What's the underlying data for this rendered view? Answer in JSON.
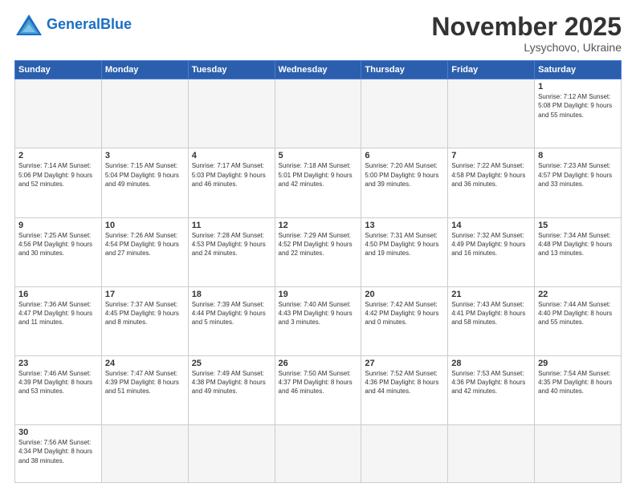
{
  "header": {
    "logo_general": "General",
    "logo_blue": "Blue",
    "month_title": "November 2025",
    "location": "Lysychovo, Ukraine"
  },
  "days_of_week": [
    "Sunday",
    "Monday",
    "Tuesday",
    "Wednesday",
    "Thursday",
    "Friday",
    "Saturday"
  ],
  "weeks": [
    [
      {
        "day": "",
        "info": ""
      },
      {
        "day": "",
        "info": ""
      },
      {
        "day": "",
        "info": ""
      },
      {
        "day": "",
        "info": ""
      },
      {
        "day": "",
        "info": ""
      },
      {
        "day": "",
        "info": ""
      },
      {
        "day": "1",
        "info": "Sunrise: 7:12 AM\nSunset: 5:08 PM\nDaylight: 9 hours\nand 55 minutes."
      }
    ],
    [
      {
        "day": "2",
        "info": "Sunrise: 7:14 AM\nSunset: 5:06 PM\nDaylight: 9 hours\nand 52 minutes."
      },
      {
        "day": "3",
        "info": "Sunrise: 7:15 AM\nSunset: 5:04 PM\nDaylight: 9 hours\nand 49 minutes."
      },
      {
        "day": "4",
        "info": "Sunrise: 7:17 AM\nSunset: 5:03 PM\nDaylight: 9 hours\nand 46 minutes."
      },
      {
        "day": "5",
        "info": "Sunrise: 7:18 AM\nSunset: 5:01 PM\nDaylight: 9 hours\nand 42 minutes."
      },
      {
        "day": "6",
        "info": "Sunrise: 7:20 AM\nSunset: 5:00 PM\nDaylight: 9 hours\nand 39 minutes."
      },
      {
        "day": "7",
        "info": "Sunrise: 7:22 AM\nSunset: 4:58 PM\nDaylight: 9 hours\nand 36 minutes."
      },
      {
        "day": "8",
        "info": "Sunrise: 7:23 AM\nSunset: 4:57 PM\nDaylight: 9 hours\nand 33 minutes."
      }
    ],
    [
      {
        "day": "9",
        "info": "Sunrise: 7:25 AM\nSunset: 4:56 PM\nDaylight: 9 hours\nand 30 minutes."
      },
      {
        "day": "10",
        "info": "Sunrise: 7:26 AM\nSunset: 4:54 PM\nDaylight: 9 hours\nand 27 minutes."
      },
      {
        "day": "11",
        "info": "Sunrise: 7:28 AM\nSunset: 4:53 PM\nDaylight: 9 hours\nand 24 minutes."
      },
      {
        "day": "12",
        "info": "Sunrise: 7:29 AM\nSunset: 4:52 PM\nDaylight: 9 hours\nand 22 minutes."
      },
      {
        "day": "13",
        "info": "Sunrise: 7:31 AM\nSunset: 4:50 PM\nDaylight: 9 hours\nand 19 minutes."
      },
      {
        "day": "14",
        "info": "Sunrise: 7:32 AM\nSunset: 4:49 PM\nDaylight: 9 hours\nand 16 minutes."
      },
      {
        "day": "15",
        "info": "Sunrise: 7:34 AM\nSunset: 4:48 PM\nDaylight: 9 hours\nand 13 minutes."
      }
    ],
    [
      {
        "day": "16",
        "info": "Sunrise: 7:36 AM\nSunset: 4:47 PM\nDaylight: 9 hours\nand 11 minutes."
      },
      {
        "day": "17",
        "info": "Sunrise: 7:37 AM\nSunset: 4:45 PM\nDaylight: 9 hours\nand 8 minutes."
      },
      {
        "day": "18",
        "info": "Sunrise: 7:39 AM\nSunset: 4:44 PM\nDaylight: 9 hours\nand 5 minutes."
      },
      {
        "day": "19",
        "info": "Sunrise: 7:40 AM\nSunset: 4:43 PM\nDaylight: 9 hours\nand 3 minutes."
      },
      {
        "day": "20",
        "info": "Sunrise: 7:42 AM\nSunset: 4:42 PM\nDaylight: 9 hours\nand 0 minutes."
      },
      {
        "day": "21",
        "info": "Sunrise: 7:43 AM\nSunset: 4:41 PM\nDaylight: 8 hours\nand 58 minutes."
      },
      {
        "day": "22",
        "info": "Sunrise: 7:44 AM\nSunset: 4:40 PM\nDaylight: 8 hours\nand 55 minutes."
      }
    ],
    [
      {
        "day": "23",
        "info": "Sunrise: 7:46 AM\nSunset: 4:39 PM\nDaylight: 8 hours\nand 53 minutes."
      },
      {
        "day": "24",
        "info": "Sunrise: 7:47 AM\nSunset: 4:39 PM\nDaylight: 8 hours\nand 51 minutes."
      },
      {
        "day": "25",
        "info": "Sunrise: 7:49 AM\nSunset: 4:38 PM\nDaylight: 8 hours\nand 49 minutes."
      },
      {
        "day": "26",
        "info": "Sunrise: 7:50 AM\nSunset: 4:37 PM\nDaylight: 8 hours\nand 46 minutes."
      },
      {
        "day": "27",
        "info": "Sunrise: 7:52 AM\nSunset: 4:36 PM\nDaylight: 8 hours\nand 44 minutes."
      },
      {
        "day": "28",
        "info": "Sunrise: 7:53 AM\nSunset: 4:36 PM\nDaylight: 8 hours\nand 42 minutes."
      },
      {
        "day": "29",
        "info": "Sunrise: 7:54 AM\nSunset: 4:35 PM\nDaylight: 8 hours\nand 40 minutes."
      }
    ],
    [
      {
        "day": "30",
        "info": "Sunrise: 7:56 AM\nSunset: 4:34 PM\nDaylight: 8 hours\nand 38 minutes."
      },
      {
        "day": "",
        "info": ""
      },
      {
        "day": "",
        "info": ""
      },
      {
        "day": "",
        "info": ""
      },
      {
        "day": "",
        "info": ""
      },
      {
        "day": "",
        "info": ""
      },
      {
        "day": "",
        "info": ""
      }
    ]
  ]
}
